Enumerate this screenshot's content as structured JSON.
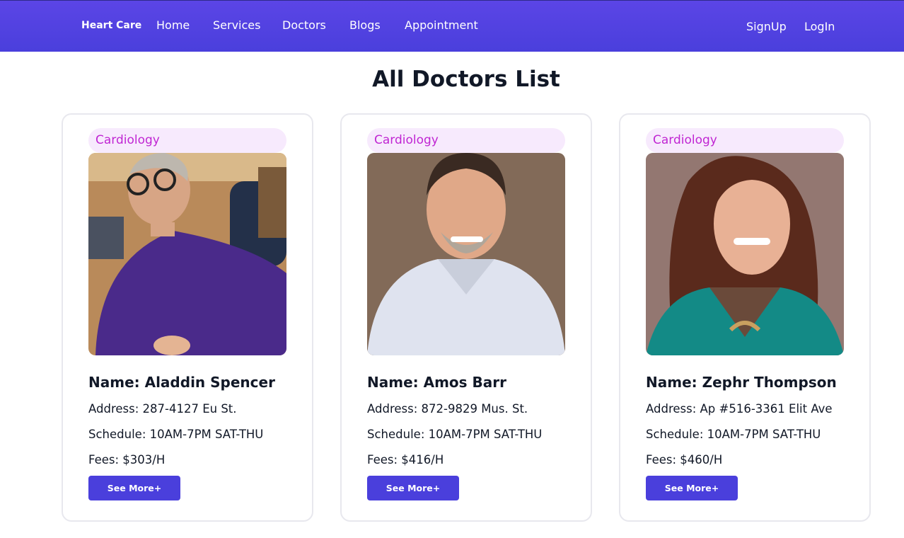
{
  "nav": {
    "brand": "Heart Care",
    "links": [
      "Home",
      "Services",
      "Doctors",
      "Blogs",
      "Appointment"
    ],
    "signup": "SignUp",
    "login": "LogIn"
  },
  "page": {
    "title": "All Doctors List"
  },
  "doctors": [
    {
      "specialty": "Cardiology",
      "name": "Name: Aladdin Spencer",
      "address": "Address: 287-4127 Eu St.",
      "schedule": "Schedule: 10AM-7PM SAT-THU",
      "fees": "Fees: $303/H",
      "button": "See More+"
    },
    {
      "specialty": "Cardiology",
      "name": "Name: Amos Barr",
      "address": "Address: 872-9829 Mus. St.",
      "schedule": "Schedule: 10AM-7PM SAT-THU",
      "fees": "Fees: $416/H",
      "button": "See More+"
    },
    {
      "specialty": "Cardiology",
      "name": "Name: Zephr Thompson",
      "address": "Address: Ap #516-3361 Elit Ave",
      "schedule": "Schedule: 10AM-7PM SAT-THU",
      "fees": "Fees: $460/H",
      "button": "See More+"
    }
  ],
  "colors": {
    "primary": "#4a3fdc",
    "specialty_text": "#c026d3",
    "specialty_bg": "#f7eafd"
  }
}
